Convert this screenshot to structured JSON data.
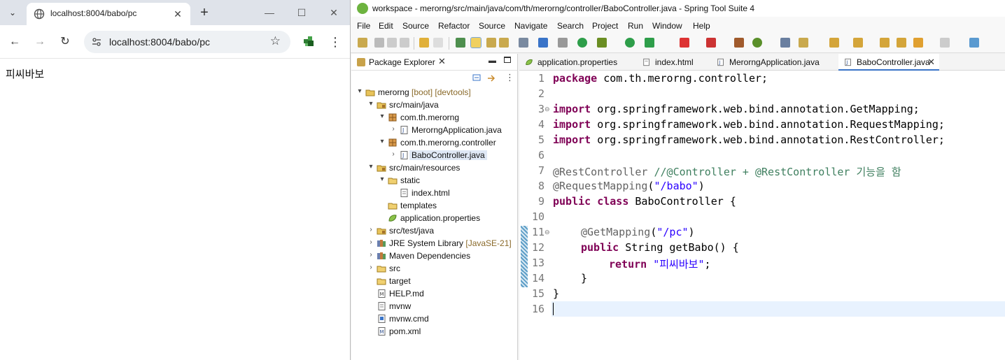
{
  "browser": {
    "tab_title": "localhost:8004/babo/pc",
    "url": "localhost:8004/babo/pc",
    "page_text": "피씨바보",
    "new_tab": "+",
    "tab_search": "⌄",
    "menu": "⋮"
  },
  "ide": {
    "window_title": "workspace - merorng/src/main/java/com/th/merorng/controller/BaboController.java - Spring Tool Suite 4",
    "menus": [
      "File",
      "Edit",
      "Source",
      "Refactor",
      "Source",
      "Navigate",
      "Search",
      "Project",
      "Run",
      "Window",
      "Help"
    ],
    "package_explorer": {
      "title": "Package Explorer",
      "tree": [
        {
          "label": "merorng",
          "decoration": " [boot] [devtools]"
        },
        {
          "label": "src/main/java"
        },
        {
          "label": "com.th.merorng"
        },
        {
          "label": "MerorngApplication.java"
        },
        {
          "label": "com.th.merorng.controller"
        },
        {
          "label": "BaboController.java"
        },
        {
          "label": "src/main/resources"
        },
        {
          "label": "static"
        },
        {
          "label": "index.html"
        },
        {
          "label": "templates"
        },
        {
          "label": "application.properties"
        },
        {
          "label": "src/test/java"
        },
        {
          "label": "JRE System Library",
          "decoration": " [JavaSE-21]"
        },
        {
          "label": "Maven Dependencies"
        },
        {
          "label": "src"
        },
        {
          "label": "target"
        },
        {
          "label": "HELP.md"
        },
        {
          "label": "mvnw"
        },
        {
          "label": "mvnw.cmd"
        },
        {
          "label": "pom.xml"
        }
      ]
    },
    "editor_tabs": [
      "application.properties",
      "index.html",
      "MerorngApplication.java",
      "BaboController.java"
    ],
    "line_numbers": [
      "1",
      "2",
      "3",
      "4",
      "5",
      "6",
      "7",
      "8",
      "9",
      "10",
      "11",
      "12",
      "13",
      "14",
      "15",
      "16"
    ],
    "code": {
      "l1_kw": "package",
      "l1_rest": " com.th.merorng.controller;",
      "l3_kw": "import",
      "l3_rest": " org.springframework.web.bind.annotation.GetMapping;",
      "l4_kw": "import",
      "l4_rest": " org.springframework.web.bind.annotation.RequestMapping;",
      "l5_kw": "import",
      "l5_rest": " org.springframework.web.bind.annotation.RestController;",
      "l7_an": "@RestController",
      "l7_cm": " //@Controller + @RestController 기능을 함",
      "l8_an": "@RequestMapping",
      "l8_p1": "(",
      "l8_st": "\"/babo\"",
      "l8_p2": ")",
      "l9_kw": "public class",
      "l9_rest": " BaboController {",
      "l11_an": "@GetMapping",
      "l11_p1": "(",
      "l11_st": "\"/pc\"",
      "l11_p2": ")",
      "l12_kw": "public",
      "l12_rest": " String getBabo() {",
      "l13_kw": "return",
      "l13_sp": " ",
      "l13_st": "\"피씨바보\"",
      "l13_end": ";",
      "l14": "}",
      "l15": "}"
    }
  }
}
